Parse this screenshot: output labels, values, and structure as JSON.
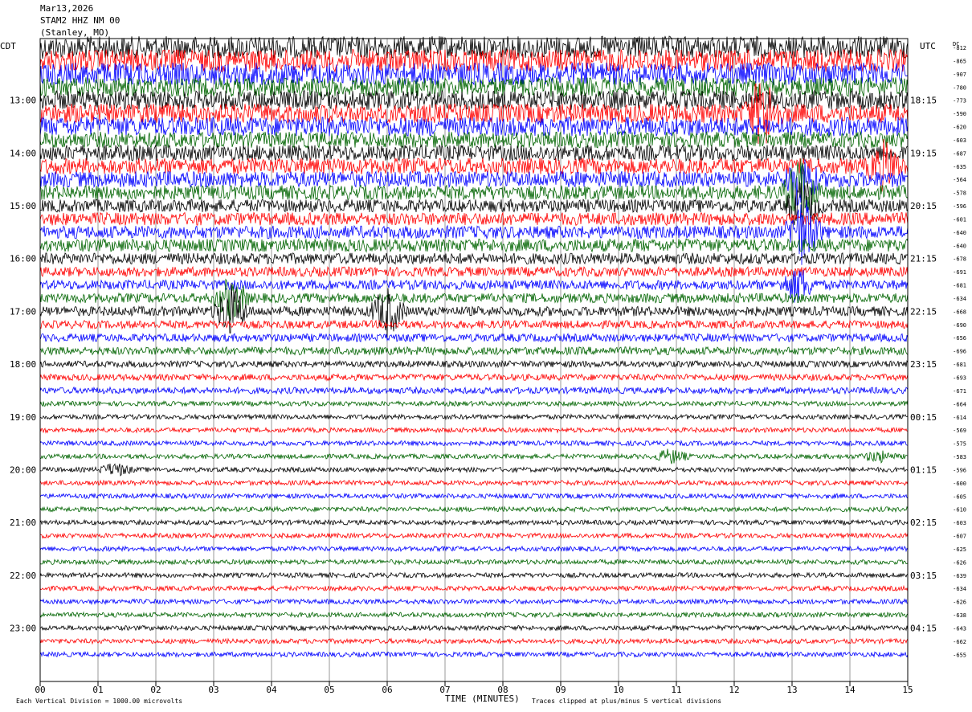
{
  "header": {
    "date": "Mar13,2026",
    "station": "STAM2 HHZ NM 00",
    "location": "(Stanley, MO)"
  },
  "labels": {
    "left_tz": "CDT",
    "right_tz": "UTC",
    "dc": "DC",
    "xlabel": "TIME (MINUTES)",
    "scale_note": "Each Vertical Division = 1000.00 microvolts",
    "clip_note": "Traces clipped at plus/minus 5 vertical divisions"
  },
  "chart_data": {
    "type": "line",
    "title": "STAM2 HHZ NM 00",
    "xlabel": "TIME (MINUTES)",
    "xlim": [
      0,
      15
    ],
    "x_ticks": [
      "00",
      "01",
      "02",
      "03",
      "04",
      "05",
      "06",
      "07",
      "08",
      "09",
      "10",
      "11",
      "12",
      "13",
      "14",
      "15"
    ],
    "trace_interval_minutes": 15,
    "trace_colors": [
      "#000000",
      "#ff0000",
      "#0000ff",
      "#006400"
    ],
    "left_hour_labels": [
      "13:00",
      "14:00",
      "15:00",
      "16:00",
      "17:00",
      "18:00",
      "19:00",
      "20:00",
      "21:00",
      "22:00",
      "23:00"
    ],
    "right_hour_labels": [
      "18:15",
      "19:15",
      "20:15",
      "21:15",
      "22:15",
      "23:15",
      "00:15",
      "01:15",
      "02:15",
      "03:15",
      "04:15"
    ],
    "dc_offsets": [
      -812,
      -865,
      -907,
      -780,
      -773,
      -590,
      -620,
      -603,
      -687,
      -635,
      -564,
      -578,
      -596,
      -601,
      -640,
      -640,
      -678,
      -691,
      -681,
      -634,
      -668,
      -690,
      -656,
      -696,
      -681,
      -693,
      -671,
      -664,
      -614,
      -569,
      -575,
      -583,
      -596,
      -600,
      -605,
      -610,
      -603,
      -607,
      -625,
      -626,
      -639,
      -634,
      -626,
      -638,
      -643,
      -662,
      -655
    ],
    "trace_noise_level": [
      14,
      14,
      14,
      12,
      12,
      12,
      12,
      10,
      10,
      10,
      10,
      9,
      8,
      8,
      8,
      8,
      7,
      6,
      6,
      6,
      6,
      5,
      5,
      5,
      4,
      4,
      4,
      3,
      3,
      3,
      3,
      3,
      3,
      3,
      3,
      3,
      3,
      3,
      3,
      3,
      3,
      3,
      3,
      3,
      3,
      3,
      3
    ],
    "events": [
      {
        "trace": 5,
        "minute": 12.5,
        "amplitude": 40
      },
      {
        "trace": 9,
        "minute": 14.6,
        "amplitude": 25
      },
      {
        "trace": 10,
        "minute": 13.15,
        "amplitude": 30
      },
      {
        "trace": 11,
        "minute": 13.15,
        "amplitude": 38
      },
      {
        "trace": 12,
        "minute": 13.2,
        "amplitude": 30
      },
      {
        "trace": 14,
        "minute": 13.2,
        "amplitude": 40
      },
      {
        "trace": 18,
        "minute": 13.1,
        "amplitude": 20
      },
      {
        "trace": 19,
        "minute": 3.3,
        "amplitude": 25
      },
      {
        "trace": 20,
        "minute": 3.3,
        "amplitude": 30
      },
      {
        "trace": 20,
        "minute": 6.0,
        "amplitude": 28
      },
      {
        "trace": 31,
        "minute": 10.9,
        "amplitude": 8
      },
      {
        "trace": 31,
        "minute": 14.5,
        "amplitude": 6
      },
      {
        "trace": 32,
        "minute": 1.3,
        "amplitude": 7
      }
    ]
  }
}
